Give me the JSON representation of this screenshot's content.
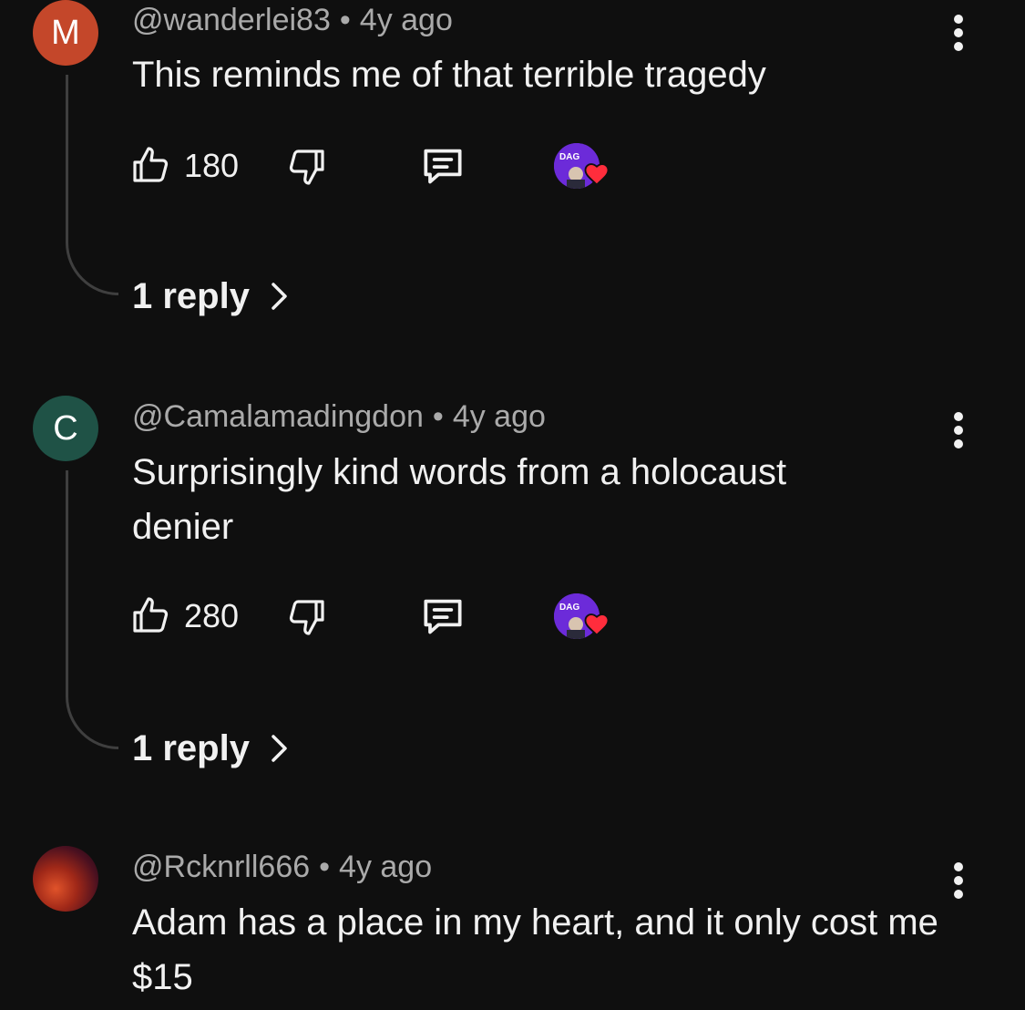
{
  "comments": [
    {
      "avatar_letter": "M",
      "avatar_color": "#c4472a",
      "handle": "@wanderlei83",
      "separator": "•",
      "time": "4y ago",
      "text": "This reminds me of that terrible tragedy",
      "likes": "180",
      "replies_label": "1 reply",
      "creator_hearted": true
    },
    {
      "avatar_letter": "C",
      "avatar_color": "#1f5246",
      "handle": "@Camalamadingdon",
      "separator": "•",
      "time": "4y ago",
      "text": "Surprisingly kind words from a holocaust denier",
      "likes": "280",
      "replies_label": "1 reply",
      "creator_hearted": true
    },
    {
      "avatar_letter": "",
      "avatar_color": "#8a2a1a",
      "handle": "@Rcknrll666",
      "separator": "•",
      "time": "4y ago",
      "text": "Adam has a place in my heart, and it only cost me $15"
    }
  ],
  "creator_avatar_text": "DAG",
  "colors": {
    "background": "#0f0f0f",
    "text_primary": "#f1f1f1",
    "text_secondary": "#aaaaaa",
    "heart": "#ff2d3c",
    "creator_purple": "#6c2bd9"
  }
}
